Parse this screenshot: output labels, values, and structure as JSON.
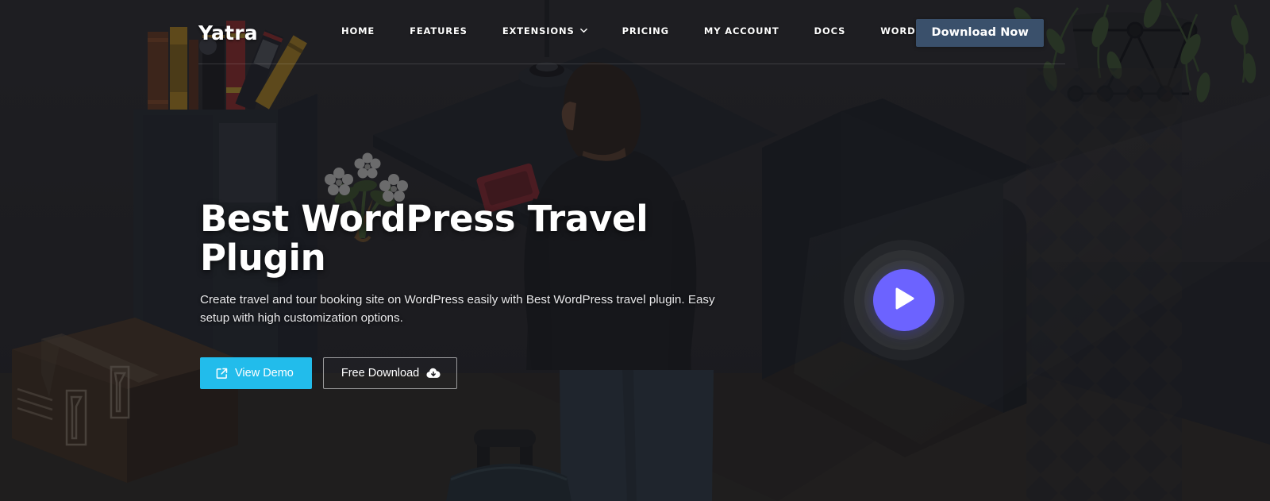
{
  "site": {
    "brand": "Yatra"
  },
  "header": {
    "nav_items": [
      {
        "label": "HOME",
        "name": "nav-home",
        "has_dropdown": false
      },
      {
        "label": "FEATURES",
        "name": "nav-features",
        "has_dropdown": false
      },
      {
        "label": "EXTENSIONS",
        "name": "nav-extensions",
        "has_dropdown": true
      },
      {
        "label": "PRICING",
        "name": "nav-pricing",
        "has_dropdown": false
      },
      {
        "label": "MY ACCOUNT",
        "name": "nav-my-account",
        "has_dropdown": false
      },
      {
        "label": "DOCS",
        "name": "nav-docs",
        "has_dropdown": false
      },
      {
        "label": "WORDPRESS TRAVEL THEME",
        "name": "nav-wp-theme",
        "has_dropdown": false
      }
    ],
    "download_button": "Download Now",
    "download_button_color": "#3a506b"
  },
  "hero": {
    "title": "Best WordPress Travel Plugin",
    "subtitle": "Create travel and tour booking site on WordPress easily with Best WordPress travel plugin. Easy setup with high customization options.",
    "primary_cta": "View Demo",
    "primary_cta_color": "#22bceb",
    "primary_cta_icon": "external-link-icon",
    "secondary_cta": "Free Download",
    "secondary_cta_icon": "cloud-download-icon",
    "play_button_icon": "play-icon",
    "play_button_color": "#6c63ff"
  },
  "background": {
    "base_color": "#26262a",
    "description": "Dark isometric illustration of a room: man seen from behind with backpack, bookshelf with colored books, flower bouquet, cardboard box, rolling suitcase, sofa, hanging plant and patterned curtain"
  }
}
